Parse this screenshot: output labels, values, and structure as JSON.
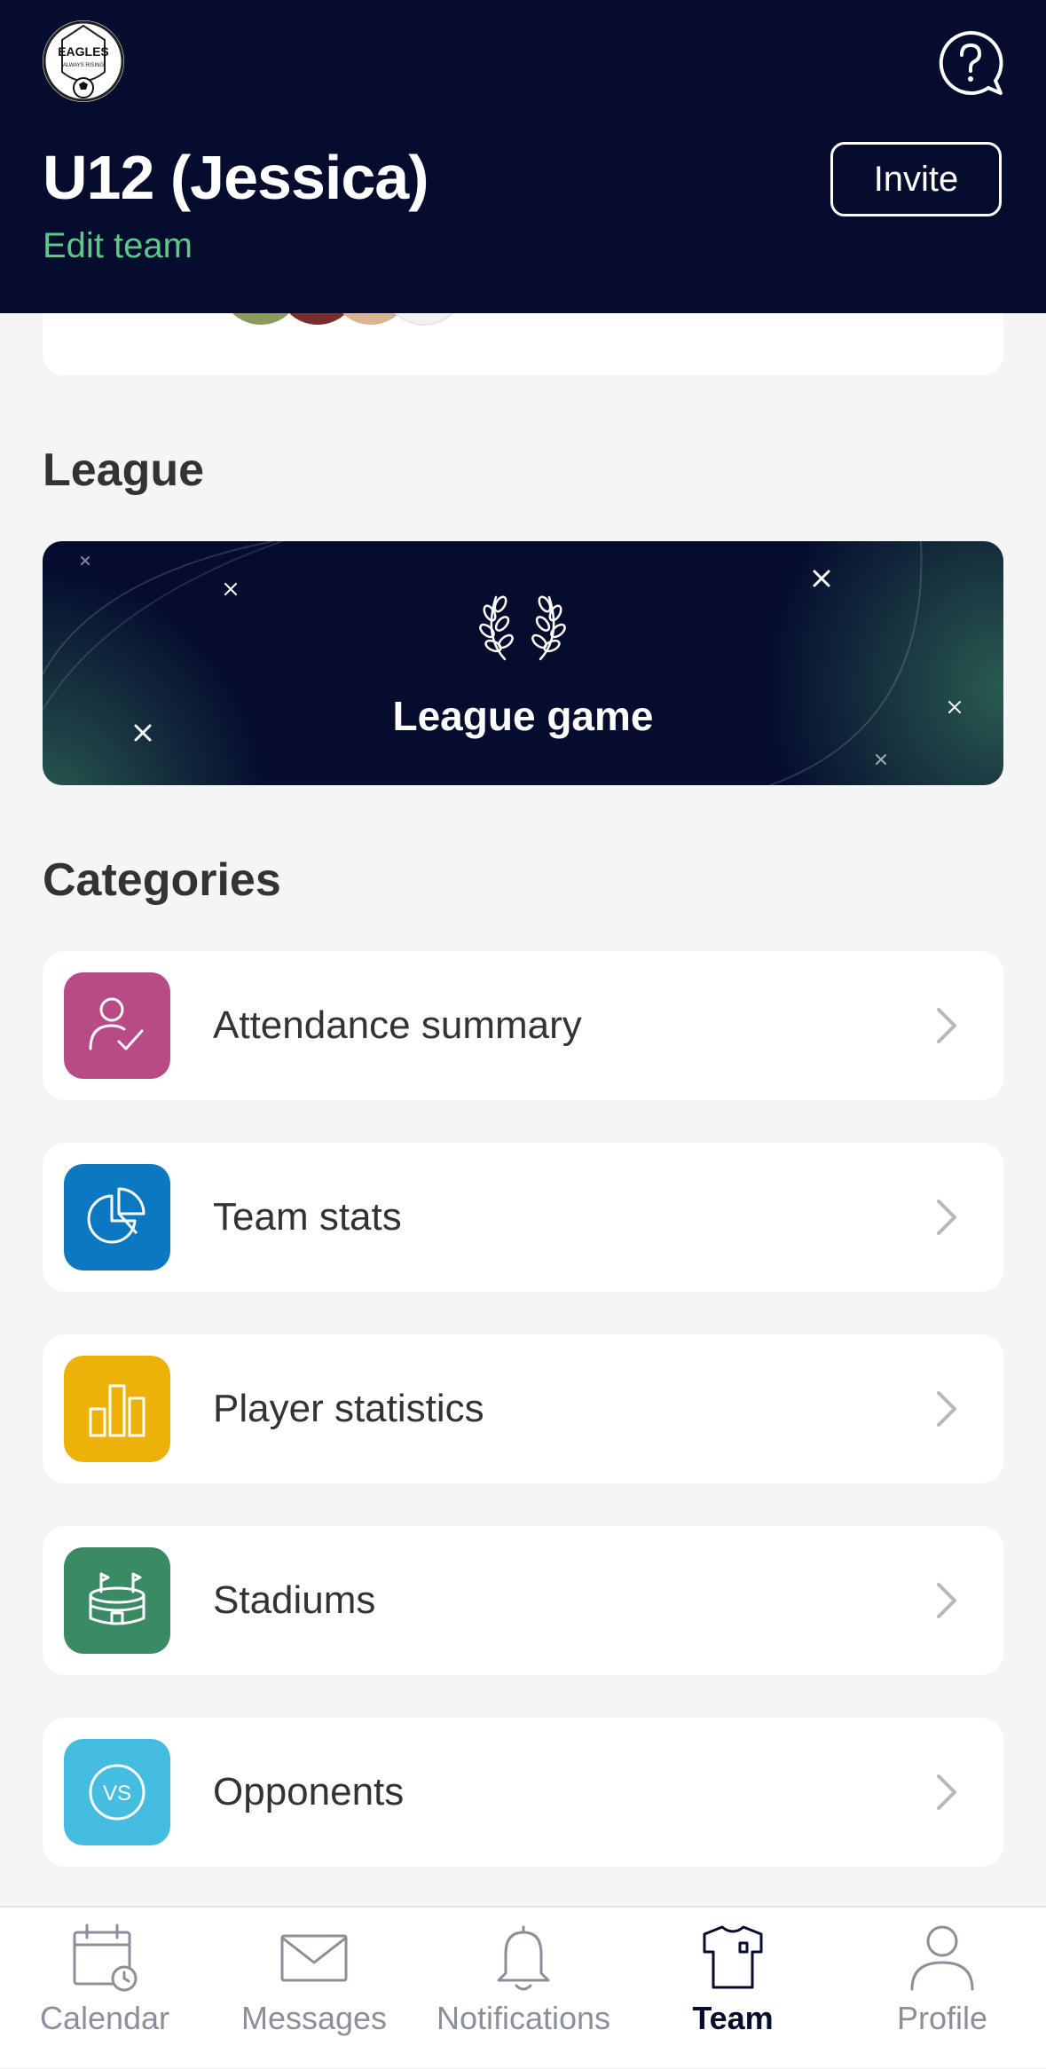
{
  "header": {
    "logo_text": "EAGLES",
    "logo_subtext": "ALWAYS RISING",
    "team_name": "U12 (Jessica)",
    "edit_team_label": "Edit team",
    "invite_label": "Invite"
  },
  "league": {
    "section_title": "League",
    "banner_label": "League game"
  },
  "categories": {
    "section_title": "Categories",
    "items": [
      {
        "label": "Attendance summary",
        "icon": "attendance-icon",
        "color": "#b84a86"
      },
      {
        "label": "Team stats",
        "icon": "pie-chart-icon",
        "color": "#0b78c1"
      },
      {
        "label": "Player statistics",
        "icon": "bar-chart-icon",
        "color": "#ecb20a"
      },
      {
        "label": "Stadiums",
        "icon": "stadium-icon",
        "color": "#3a8a64"
      },
      {
        "label": "Opponents",
        "icon": "vs-icon",
        "color": "#45bde0"
      }
    ]
  },
  "bottom_nav": {
    "items": [
      {
        "label": "Calendar",
        "icon": "calendar-icon"
      },
      {
        "label": "Messages",
        "icon": "envelope-icon"
      },
      {
        "label": "Notifications",
        "icon": "bell-icon"
      },
      {
        "label": "Team",
        "icon": "shirt-icon",
        "active": true
      },
      {
        "label": "Profile",
        "icon": "profile-icon"
      }
    ]
  },
  "colors": {
    "header_bg": "#050c2e",
    "accent_green": "#5cc98a",
    "page_bg": "#f5f5f5"
  }
}
